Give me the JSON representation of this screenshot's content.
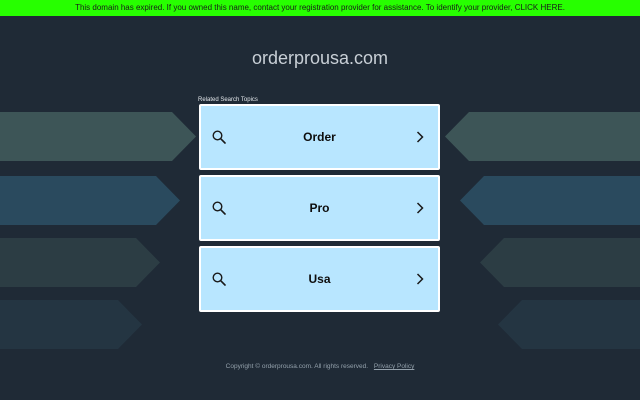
{
  "banner": {
    "text": "This domain has expired. If you owned this name, contact your registration provider for assistance. To identify your provider, CLICK HERE.",
    "color": "#27ff00"
  },
  "domain": "orderprousa.com",
  "related_label": "Related Search Topics",
  "tiles": [
    {
      "label": "Order",
      "icon": "search-icon",
      "arrow": "chevron-right-icon"
    },
    {
      "label": "Pro",
      "icon": "search-icon",
      "arrow": "chevron-right-icon"
    },
    {
      "label": "Usa",
      "icon": "search-icon",
      "arrow": "chevron-right-icon"
    }
  ],
  "footer": {
    "copyright": "Copyright © orderprousa.com.  All rights reserved.",
    "privacy": "Privacy Policy"
  },
  "colors": {
    "background": "#1f2a36",
    "tile": "#b8e6ff"
  }
}
